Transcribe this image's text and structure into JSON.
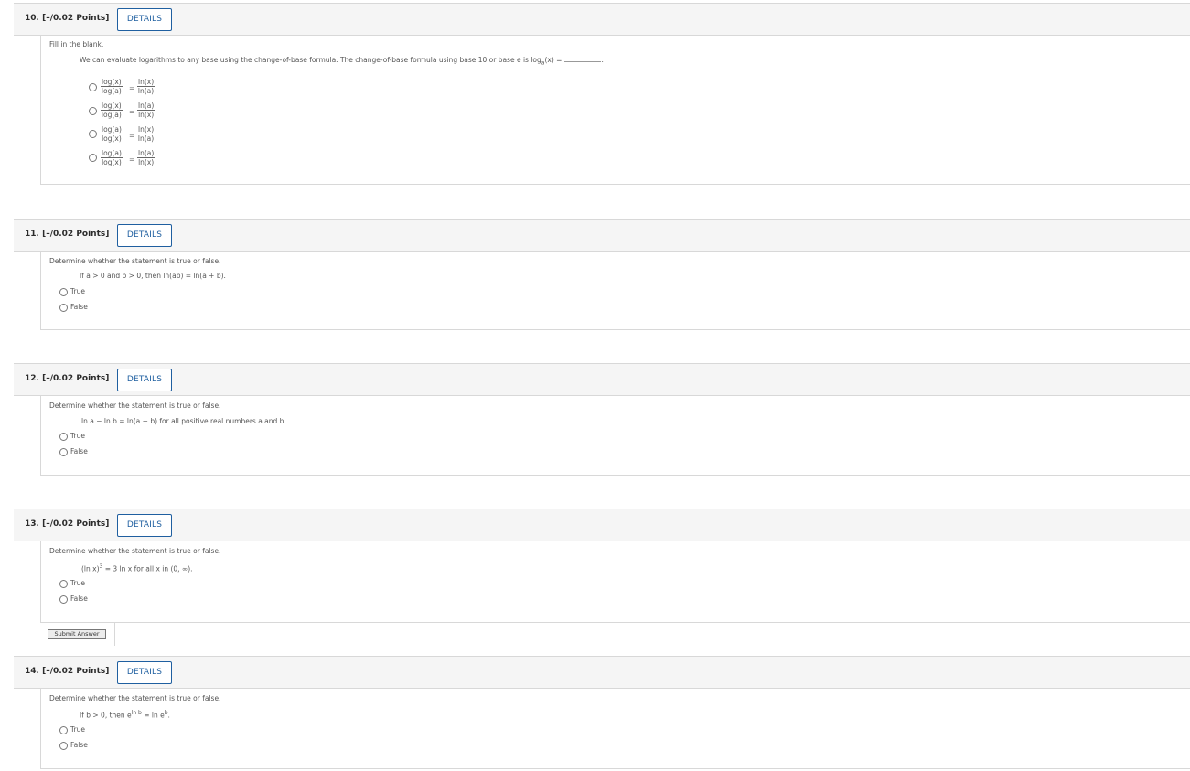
{
  "questions": [
    {
      "title": "10. [–/0.02 Points]",
      "details": "DETAILS",
      "prompt": "Fill in the blank.",
      "statement": "We can evaluate logarithms to any base using the change-of-base formula. The change-of-base formula using base 10 or base e is log",
      "statement_sub": "a",
      "statement_tail": "(x) =",
      "options": [
        {
          "n1": "log(x)",
          "d1": "log(a)",
          "n2": "ln(x)",
          "d2": "ln(a)"
        },
        {
          "n1": "log(x)",
          "d1": "log(a)",
          "n2": "ln(a)",
          "d2": "ln(x)"
        },
        {
          "n1": "log(a)",
          "d1": "log(x)",
          "n2": "ln(x)",
          "d2": "ln(a)"
        },
        {
          "n1": "log(a)",
          "d1": "log(x)",
          "n2": "ln(a)",
          "d2": "ln(x)"
        }
      ],
      "equals": "="
    },
    {
      "title": "11. [–/0.02 Points]",
      "details": "DETAILS",
      "prompt": "Determine whether the statement is true or false.",
      "statement": "If a > 0 and b > 0, then ln(ab) = ln(a + b).",
      "options": [
        "True",
        "False"
      ]
    },
    {
      "title": "12. [–/0.02 Points]",
      "details": "DETAILS",
      "prompt": "Determine whether the statement is true or false.",
      "statement": "ln a − ln b = ln(a − b)  for all positive real numbers a and b.",
      "options": [
        "True",
        "False"
      ]
    },
    {
      "title": "13. [–/0.02 Points]",
      "details": "DETAILS",
      "prompt": "Determine whether the statement is true or false.",
      "statement_pre": "(ln x)",
      "statement_sup": "3",
      "statement_post": " = 3 ln x  for all x in  (0, ∞).",
      "options": [
        "True",
        "False"
      ],
      "submit": "Submit Answer"
    },
    {
      "title": "14. [–/0.02 Points]",
      "details": "DETAILS",
      "prompt": "Determine whether the statement is true or false.",
      "statement_pre": "If  b > 0,  then  e",
      "statement_sup1": "ln b",
      "statement_mid": " = ln e",
      "statement_sup2": "b",
      "statement_post": ".",
      "options": [
        "True",
        "False"
      ]
    }
  ]
}
